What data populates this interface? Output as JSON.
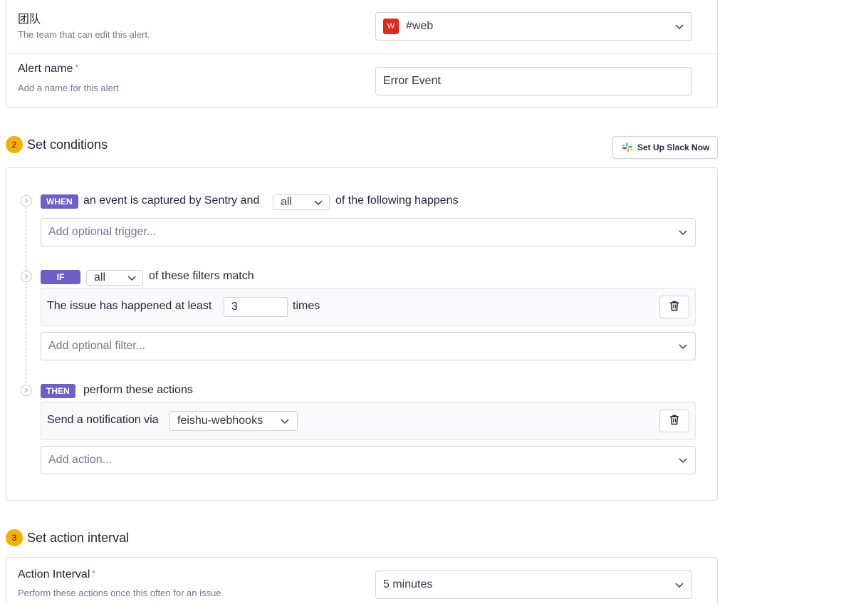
{
  "team": {
    "label": "团队",
    "help": "The team that can edit this alert.",
    "badge": "W",
    "value": "#web"
  },
  "alert_name": {
    "label": "Alert name",
    "required_mark": "*",
    "help": "Add a name for this alert",
    "value": "Error Event"
  },
  "step2": {
    "number": "2",
    "title": "Set conditions",
    "slack_button": "Set Up Slack Now"
  },
  "when": {
    "tag": "WHEN",
    "prefix": "an event is captured by Sentry and",
    "match": "all",
    "suffix": "of the following happens",
    "trigger_placeholder": "Add optional trigger..."
  },
  "if": {
    "tag": "IF",
    "match": "all",
    "suffix": "of these filters match",
    "rule_prefix": "The issue has happened at least",
    "rule_value": "3",
    "rule_suffix": "times",
    "filter_placeholder": "Add optional filter..."
  },
  "then": {
    "tag": "THEN",
    "suffix": "perform these actions",
    "action_prefix": "Send a notification via",
    "action_value": "feishu-webhooks",
    "action_placeholder": "Add action..."
  },
  "step3": {
    "number": "3",
    "title": "Set action interval"
  },
  "action_interval": {
    "label": "Action Interval",
    "required_mark": "*",
    "help": "Perform these actions once this often for an issue",
    "value": "5 minutes"
  },
  "colors": {
    "accent": "#6c5fc7",
    "step_badge": "#f5b000",
    "team_badge": "#e0291b",
    "required": "#e0557a"
  }
}
